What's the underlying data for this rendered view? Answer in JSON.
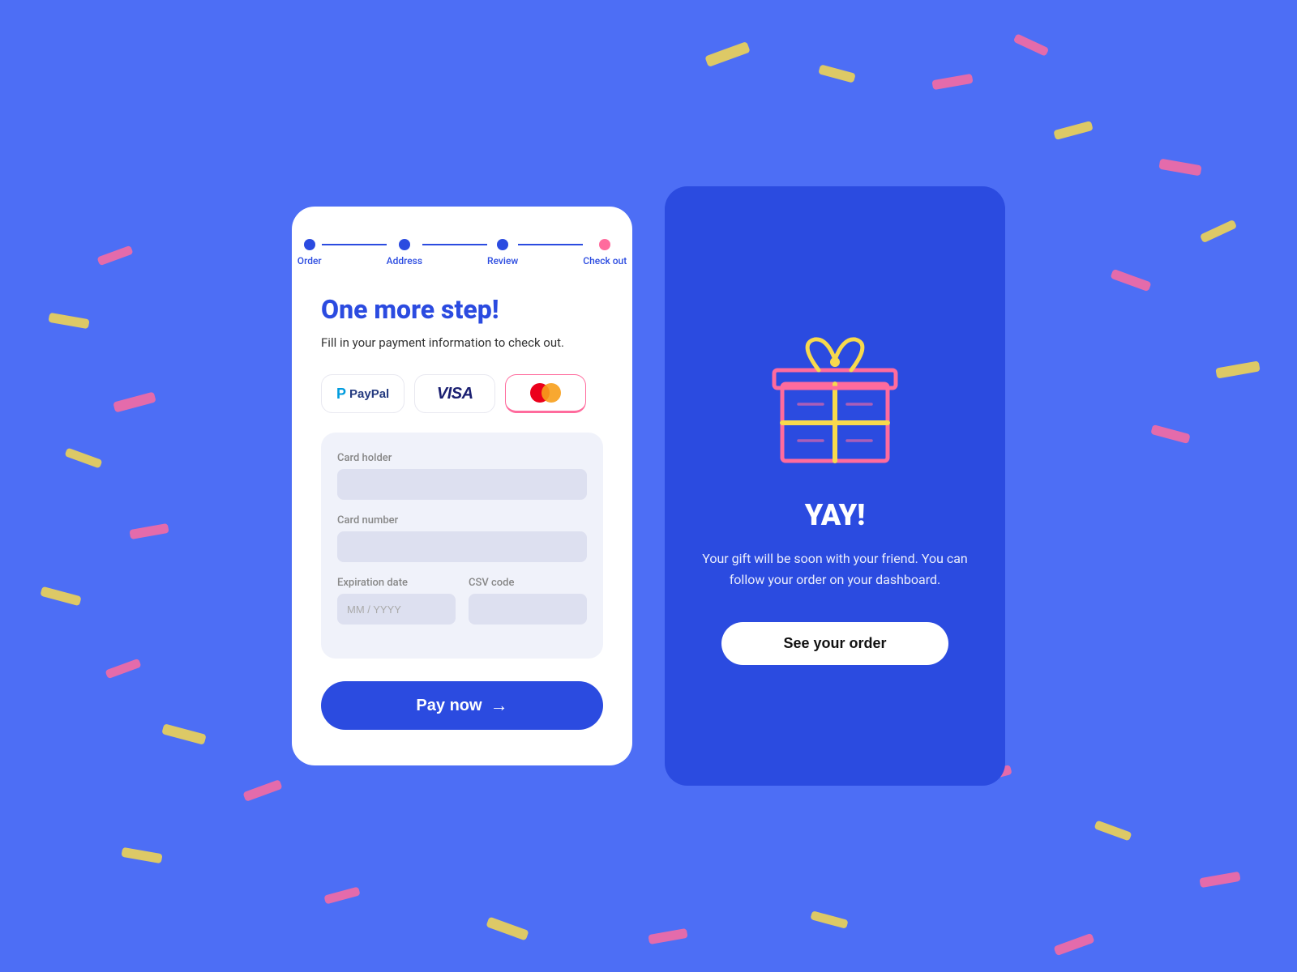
{
  "background": {
    "color": "#4d6ef5"
  },
  "stepper": {
    "steps": [
      {
        "label": "Order",
        "active": true
      },
      {
        "label": "Address",
        "active": true
      },
      {
        "label": "Review",
        "active": true
      },
      {
        "label": "Check out",
        "active": false
      }
    ]
  },
  "left_card": {
    "heading": "One more step!",
    "subheading": "Fill in your payment information\nto check out.",
    "payment_methods": [
      {
        "id": "paypal",
        "label": "PayPal",
        "active": false
      },
      {
        "id": "visa",
        "label": "VISA",
        "active": false
      },
      {
        "id": "mastercard",
        "label": "Mastercard",
        "active": true
      }
    ],
    "form": {
      "card_holder_label": "Card holder",
      "card_holder_placeholder": "",
      "card_number_label": "Card number",
      "card_number_placeholder": "",
      "expiration_label": "Expiration date",
      "expiration_placeholder": "MM / YYYY",
      "csv_label": "CSV code",
      "csv_placeholder": ""
    },
    "pay_button": "Pay now",
    "pay_button_arrow": "→"
  },
  "right_card": {
    "yay_title": "YAY!",
    "yay_subtitle": "Your gift will be soon with your\nfriend. You can follow your order\non your dashboard.",
    "see_order_button": "See your order"
  }
}
